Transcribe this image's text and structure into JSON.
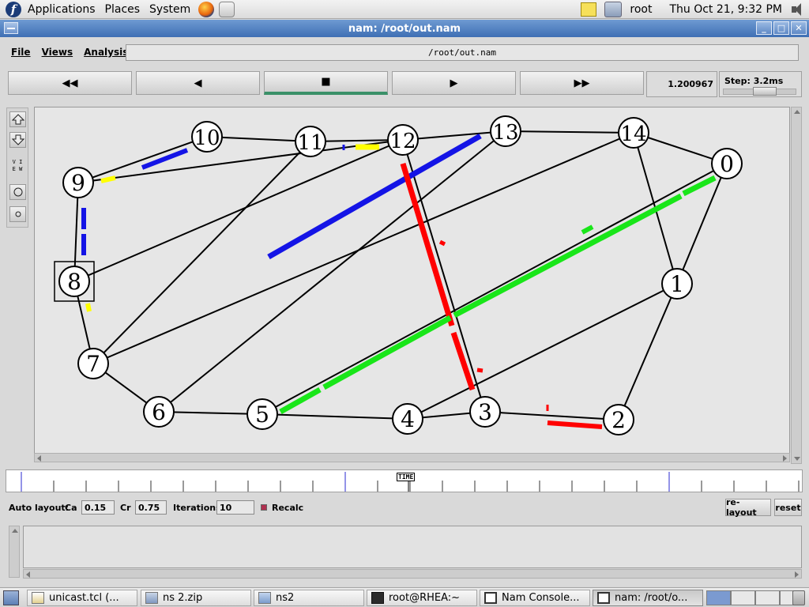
{
  "panel": {
    "menus": [
      "Applications",
      "Places",
      "System"
    ],
    "user": "root",
    "clock": "Thu Oct 21,  9:32 PM"
  },
  "window": {
    "title": "nam: /root/out.nam"
  },
  "menubar": {
    "file": "File",
    "views": "Views",
    "analysis": "Analysis",
    "path": "/root/out.nam"
  },
  "transport": {
    "buttons": [
      {
        "name": "fast-rewind-button",
        "glyph": "◀◀",
        "icon": "fast-rewind-icon"
      },
      {
        "name": "rewind-button",
        "glyph": "◀",
        "icon": "play-backward-icon"
      },
      {
        "name": "stop-button",
        "glyph": "■",
        "icon": "stop-icon",
        "active": true
      },
      {
        "name": "play-button",
        "glyph": "▶",
        "icon": "play-icon"
      },
      {
        "name": "fast-forward-button",
        "glyph": "▶▶",
        "icon": "fast-forward-icon"
      }
    ],
    "time": "1.200967",
    "step": "Step: 3.2ms"
  },
  "side_tools": {
    "view_label": "VIEW"
  },
  "network": {
    "nodes": [
      "0",
      "1",
      "2",
      "3",
      "4",
      "5",
      "6",
      "7",
      "8",
      "9",
      "10",
      "11",
      "12",
      "13",
      "14"
    ],
    "colors": {
      "blue": "#1414e6",
      "red": "#ff0000",
      "green": "#19e619",
      "yellow": "#ffff00",
      "link": "#000000"
    },
    "flows": [
      "blue",
      "red",
      "green",
      "yellow"
    ]
  },
  "timeline": {
    "label": "TIME"
  },
  "layout": {
    "auto_layout": "Auto layout:",
    "ca_label": "Ca",
    "ca_value": "0.15",
    "cr_label": "Cr",
    "cr_value": "0.75",
    "iterations_label": "Iterations",
    "iterations_value": "10",
    "recalc": "Recalc",
    "relayout": "re-layout",
    "reset": "reset"
  },
  "taskbar": {
    "tasks": [
      "unicast.tcl (...",
      "ns 2.zip",
      "ns2",
      "root@RHEA:~",
      "Nam Console...",
      "nam: /root/o..."
    ]
  }
}
